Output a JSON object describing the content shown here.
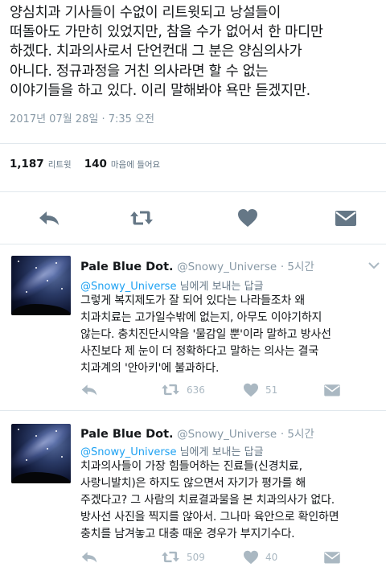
{
  "main_tweet": {
    "lines": [
      "양심치과 기사들이 수없이 리트윗되고 낭설들이",
      "떠돌아도 가만히 있었지만, 참을 수가 없어서 한 마디만",
      "하겠다. 치과의사로서 단언컨대 그 분은 양심의사가",
      "아니다. 정규과정을 거친 의사라면 할 수 없는",
      "이야기들을 하고 있다. 이리 말해봐야 욕만 듣겠지만."
    ],
    "timestamp": "2017년 07월 28일 · 7:35 오전",
    "retweet_count": "1,187",
    "retweet_label": "리트윗",
    "like_count": "140",
    "like_label": "마음에 들어요"
  },
  "replies": [
    {
      "name": "Pale Blue Dot.",
      "handle": "@Snowy_Universe",
      "time": "· 5시간",
      "reply_to_mention": "@Snowy_Universe",
      "reply_to_suffix": " 님에게 보내는 답글",
      "lines": [
        "그렇게 복지제도가 잘 되어 있다는 나라들조차 왜",
        "치과치료는 고가일수밖에 없는지, 아무도 이야기하지",
        "않는다. 충치진단시약을 '물감일 뿐'이라 말하고 방사선",
        "사진보다 제 눈이 더 정확하다고 말하는 의사는 결국",
        "치과계의 '안아키'에 불과하다."
      ],
      "retweets": "636",
      "likes": "51"
    },
    {
      "name": "Pale Blue Dot.",
      "handle": "@Snowy_Universe",
      "time": "· 5시간",
      "reply_to_mention": "@Snowy_Universe",
      "reply_to_suffix": " 님에게 보내는 답글",
      "lines": [
        "치과의사들이 가장 힘들어하는 진료들(신경치료,",
        "사랑니발치)은 하지도 않으면서 자기가 평가를 해",
        "주겠다고? 그 사람의 치료결과물을 본 치과의사가 없다.",
        "방사선 사진을 찍지를 않아서. 그나마 육안으로 확인하면",
        "충치를 남겨놓고 대충 때운 경우가 부지기수다."
      ],
      "retweets": "509",
      "likes": "40"
    }
  ],
  "icons": {
    "reply": "reply-icon",
    "retweet": "retweet-icon",
    "like": "heart-icon",
    "dm": "envelope-icon",
    "more": "chevron-down-icon"
  },
  "colors": {
    "text": "#14171a",
    "muted": "#8899a6",
    "action_main": "#657786",
    "action_reply": "#aab8c2",
    "link": "#1da1f2",
    "divider": "#e1e8ed"
  }
}
